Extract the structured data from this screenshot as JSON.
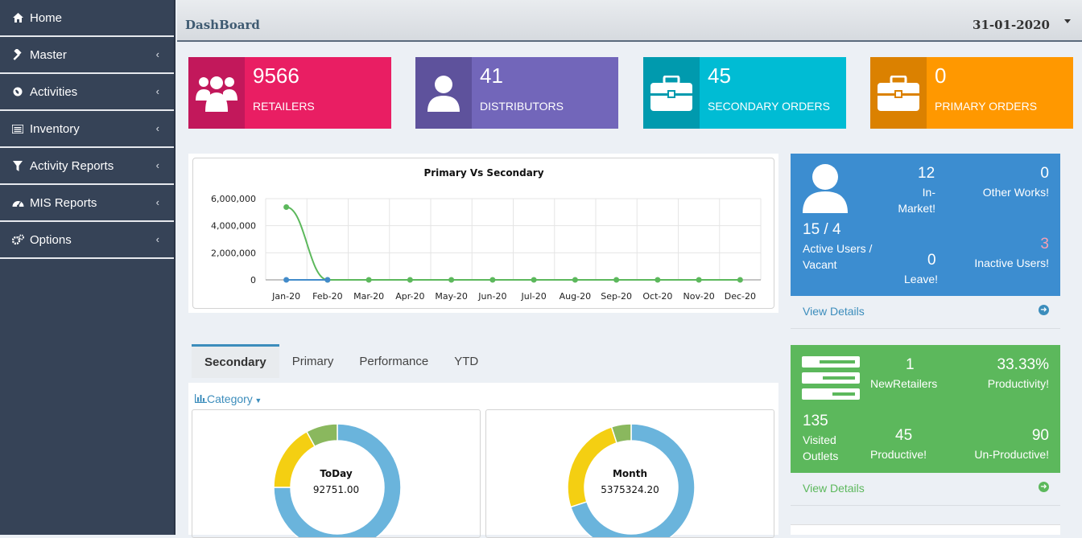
{
  "sidebar": {
    "items": [
      {
        "label": "Home",
        "icon": "home-icon",
        "has_children": false
      },
      {
        "label": "Master",
        "icon": "gavel-icon",
        "has_children": true
      },
      {
        "label": "Activities",
        "icon": "globe-icon",
        "has_children": true
      },
      {
        "label": "Inventory",
        "icon": "list-icon",
        "has_children": true
      },
      {
        "label": "Activity Reports",
        "icon": "filter-icon",
        "has_children": true
      },
      {
        "label": "MIS Reports",
        "icon": "dashboard-icon",
        "has_children": true
      },
      {
        "label": "Options",
        "icon": "gears-icon",
        "has_children": true
      }
    ]
  },
  "header": {
    "title": "DashBoard",
    "date": "31-01-2020"
  },
  "stats": [
    {
      "value": "9566",
      "label": "RETAILERS",
      "color": "#e91e63",
      "icon_bg": "#c2185b",
      "icon": "users-icon"
    },
    {
      "value": "41",
      "label": "DISTRIBUTORS",
      "color": "#7266ba",
      "icon_bg": "#5e529c",
      "icon": "user-icon"
    },
    {
      "value": "45",
      "label": "SECONDARY ORDERS",
      "color": "#00bcd4",
      "icon_bg": "#009aae",
      "icon": "briefcase-icon"
    },
    {
      "value": "0",
      "label": "PRIMARY ORDERS",
      "color": "#ff9800",
      "icon_bg": "#db8100",
      "icon": "briefcase-icon"
    }
  ],
  "chart_data": {
    "type": "line",
    "title": "Primary Vs Secondary",
    "categories": [
      "Jan-20",
      "Feb-20",
      "Mar-20",
      "Apr-20",
      "May-20",
      "Jun-20",
      "Jul-20",
      "Aug-20",
      "Sep-20",
      "Oct-20",
      "Nov-20",
      "Dec-20"
    ],
    "yticks": [
      "6,000,000",
      "4,000,000",
      "2,000,000",
      "0"
    ],
    "ylim": [
      0,
      6000000
    ],
    "series": [
      {
        "color": "#5cb85c",
        "values": [
          5375324.2,
          0,
          0,
          0,
          0,
          0,
          0,
          0,
          0,
          0,
          0,
          0
        ]
      },
      {
        "color": "#428bca",
        "values": [
          0,
          0,
          null,
          null,
          null,
          null,
          null,
          null,
          null,
          null,
          null,
          null
        ]
      }
    ]
  },
  "tabs": [
    "Secondary",
    "Primary",
    "Performance",
    "YTD"
  ],
  "active_tab": 0,
  "category_label": "Category",
  "donuts": [
    {
      "title": "ToDay",
      "value": "92751.00",
      "segments": [
        {
          "fraction": 0.75,
          "color": "#6ab4dc"
        },
        {
          "fraction": 0.17,
          "color": "#f4cf12"
        },
        {
          "fraction": 0.08,
          "color": "#8ab85e"
        }
      ]
    },
    {
      "title": "Month",
      "value": "5375324.20",
      "segments": [
        {
          "fraction": 0.7,
          "color": "#6ab4dc"
        },
        {
          "fraction": 0.25,
          "color": "#f4cf12"
        },
        {
          "fraction": 0.05,
          "color": "#8ab85e"
        }
      ]
    }
  ],
  "users_card": {
    "color": "#3c8dd0",
    "in_market": {
      "value": "12",
      "label": "In-Market!"
    },
    "other_works": {
      "value": "0",
      "label": "Other Works!"
    },
    "active": {
      "value": "15 / 4",
      "label": "Active Users / Vacant"
    },
    "leave": {
      "value": "0",
      "label": "Leave!"
    },
    "inactive": {
      "value": "3",
      "label": "Inactive Users!",
      "value_color": "#f4a0b4"
    },
    "view_details": "View Details",
    "link_color": "#3c8dbc"
  },
  "retailers_card": {
    "color": "#5cb85c",
    "new_retailers": {
      "value": "1",
      "label": "NewRetailers"
    },
    "productivity": {
      "value": "33.33%",
      "label": "Productivity!"
    },
    "visited": {
      "value": "135",
      "label": "Visited Outlets"
    },
    "productive": {
      "value": "45",
      "label": "Productive!"
    },
    "unproductive": {
      "value": "90",
      "label": "Un-Productive!"
    },
    "view_details": "View Details",
    "link_color": "#5cb85c"
  }
}
